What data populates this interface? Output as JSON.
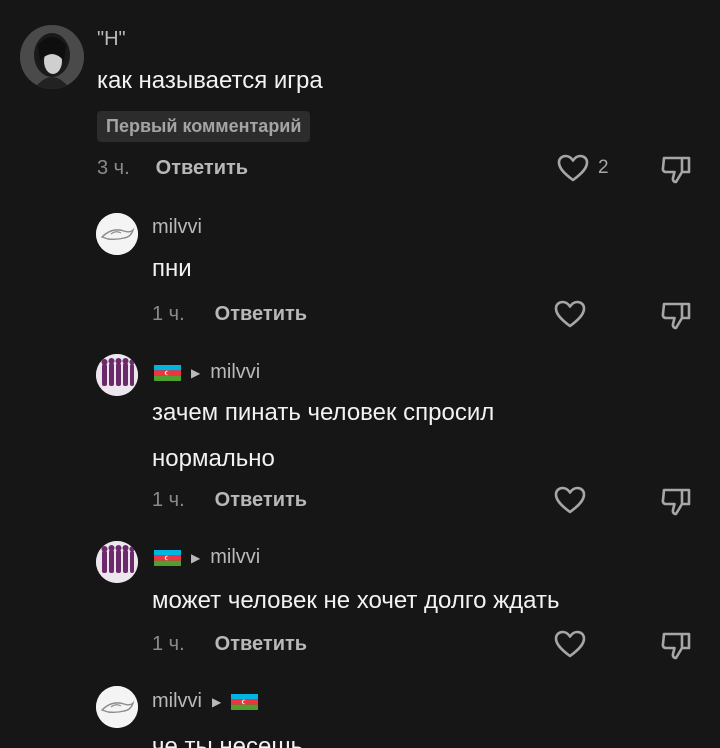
{
  "colors": {
    "background": "#161616",
    "text": "#f2f2f2",
    "muted": "#8a8a8a",
    "badge_bg": "#2c2c2c"
  },
  "comments": [
    {
      "author": "\"H\"",
      "text": "как называется игра",
      "badge": "Первый комментарий",
      "time": "3 ч.",
      "reply_label": "Ответить",
      "likes": "2",
      "avatar_icon": "dark-hair-avatar-icon"
    },
    {
      "author": "milvvi",
      "text": "пни",
      "time": "1 ч.",
      "reply_label": "Ответить",
      "avatar_icon": "white-bird-avatar-icon"
    },
    {
      "author_flag": "azerbaijan-flag-icon",
      "reply_to": "milvvi",
      "text_line1": "зачем пинать человек спросил",
      "text_line2": "нормально",
      "time": "1 ч.",
      "reply_label": "Ответить",
      "avatar_icon": "purple-figures-avatar-icon"
    },
    {
      "author_flag": "azerbaijan-flag-icon",
      "reply_to": "milvvi",
      "text": "может человек не хочет долго ждать",
      "time": "1 ч.",
      "reply_label": "Ответить",
      "avatar_icon": "purple-figures-avatar-icon"
    },
    {
      "author": "milvvi",
      "reply_to_flag": "azerbaijan-flag-icon",
      "text": "че ты несешь",
      "avatar_icon": "white-bird-avatar-icon"
    }
  ]
}
